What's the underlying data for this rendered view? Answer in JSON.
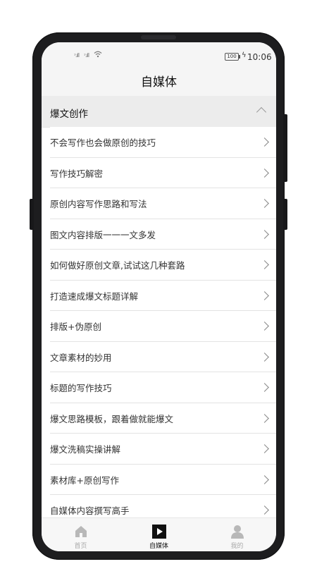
{
  "status_bar": {
    "signal_1": "ᵌ.ıll",
    "signal_2": "ᵌ.ıll",
    "battery": "100",
    "time": "10:06"
  },
  "header": {
    "title": "自媒体"
  },
  "section": {
    "label": "爆文创作",
    "expanded": true
  },
  "list": [
    {
      "label": "不会写作也会做原创的技巧"
    },
    {
      "label": "写作技巧解密"
    },
    {
      "label": "原创内容写作思路和写法"
    },
    {
      "label": "图文内容排版一一一文多发"
    },
    {
      "label": "如何做好原创文章,试试这几种套路"
    },
    {
      "label": "打造速成爆文标题详解"
    },
    {
      "label": "排版+伪原创"
    },
    {
      "label": "文章素材的妙用"
    },
    {
      "label": "标题的写作技巧"
    },
    {
      "label": "爆文思路模板，跟着做就能爆文"
    },
    {
      "label": "爆文洗稿实操讲解"
    },
    {
      "label": "素材库+原创写作"
    },
    {
      "label": "自媒体内容撰写高手"
    }
  ],
  "tabbar": {
    "tabs": [
      {
        "label": "首页",
        "icon": "home-icon",
        "active": false
      },
      {
        "label": "自媒体",
        "icon": "play-icon",
        "active": true
      },
      {
        "label": "我的",
        "icon": "user-icon",
        "active": false
      }
    ]
  },
  "colors": {
    "active_tab": "#111111",
    "inactive_tab": "#aaaaaa",
    "section_bg": "#ececec"
  }
}
